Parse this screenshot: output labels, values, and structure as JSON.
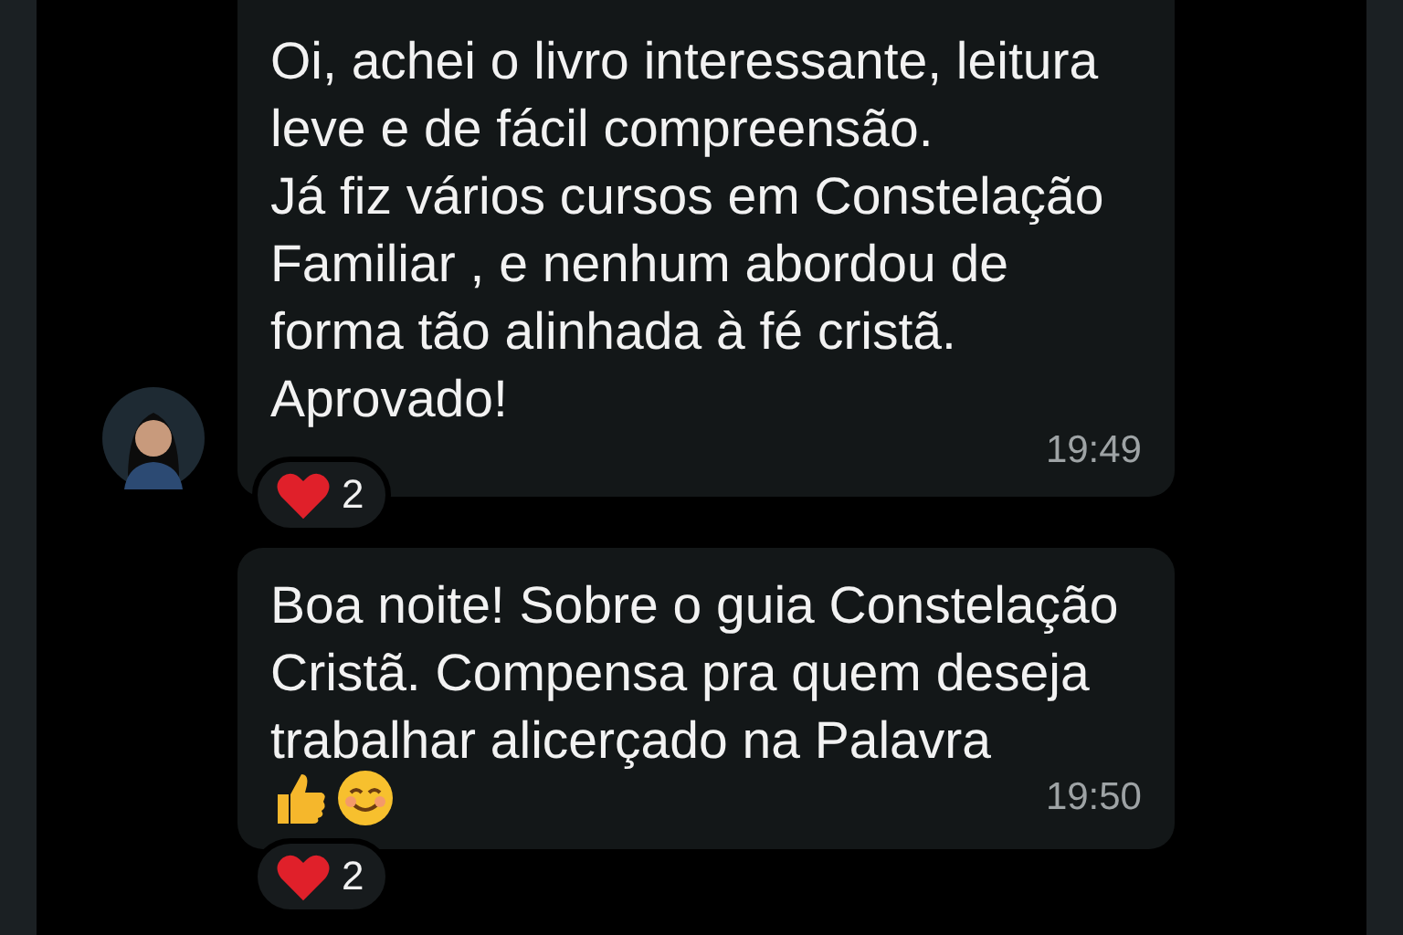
{
  "messages": [
    {
      "text": "Oi, achei o livro interessante, leitura leve e de fácil compreensão.\nJá fiz vários cursos em Constelação Familiar , e nenhum abordou de forma tão alinhada à fé cristã. Aprovado!",
      "time": "19:49",
      "avatar": true,
      "reaction": {
        "count": "2"
      }
    },
    {
      "text": "Boa noite! Sobre o guia Constelação Cristã. Compensa pra quem deseja trabalhar alicerçado na Palavra",
      "time": "19:50",
      "emojis": [
        {
          "kind": "thumbs-up"
        },
        {
          "kind": "smile"
        }
      ],
      "reaction": {
        "count": "2"
      }
    }
  ]
}
